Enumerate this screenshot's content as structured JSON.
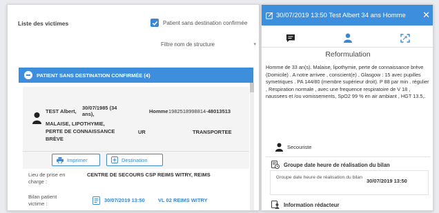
{
  "left_panel": {
    "title": "Liste des victimes",
    "checkbox_label": "Patient sans destination confirmée",
    "checkbox_checked": true,
    "filter_placeholder": "Filtre nom de structure",
    "group_header": "PATIENT SANS DESTINATION CONFIRMÉE (4)",
    "victim": {
      "name": "TEST Albert,",
      "dob": "30/07/1985 (34 ans),",
      "sex": "Homme",
      "number_prefix": "1982518998814-",
      "number_suffix": "48013513",
      "motif": "MALAISE, LIPOTHYMIE, PERTE DE CONNAISSANCE BRÈVE",
      "priority": "UR",
      "status": "TRANSPORTEE"
    },
    "buttons": {
      "print": "Imprimer",
      "destination": "Destination"
    },
    "lieu_label": "Lieu de prise en charge :",
    "lieu_value": "CENTRE DE SECOURS CSP REIMS WITRY, REIMS",
    "bilan_label": "Bilan patient victime :",
    "bilan_date": "30/07/2019 13:50",
    "bilan_vl": "VL 02 REIMS WITRY"
  },
  "right_panel": {
    "header_title": "30/07/2019 13:50 Test Albert 34 ans Homme",
    "section_title": "Reformulation",
    "reformulation": "Homme de 33 an(s). Malaise, lipothymie, perte de connaissance brève (Domicile) . A notre arrivee , conscient(e) , Glasgow : 15 avec pupilles symetriques . PA 144/80 (membre supérieur droit). P 88 par min . régulier , Respiration normale , avec une frequence respiratoire de V 18 , naussees et /ou vomissements, SpO2 99 % en air ambiant , HGT 13.5,.",
    "author": "Secouriste",
    "group_title": "Groupe date heure de réalisation du bilan",
    "group_label": "Groupe date heure de réalisation du bilan",
    "group_value": "30/07/2019 13:50",
    "info_title": "Information rédacteur"
  },
  "colors": {
    "accent": "#3d8fde",
    "link": "#3b87d6"
  },
  "icons": {
    "tab_1": "message-icon",
    "tab_2": "person-icon",
    "tab_3": "expand-icon"
  }
}
